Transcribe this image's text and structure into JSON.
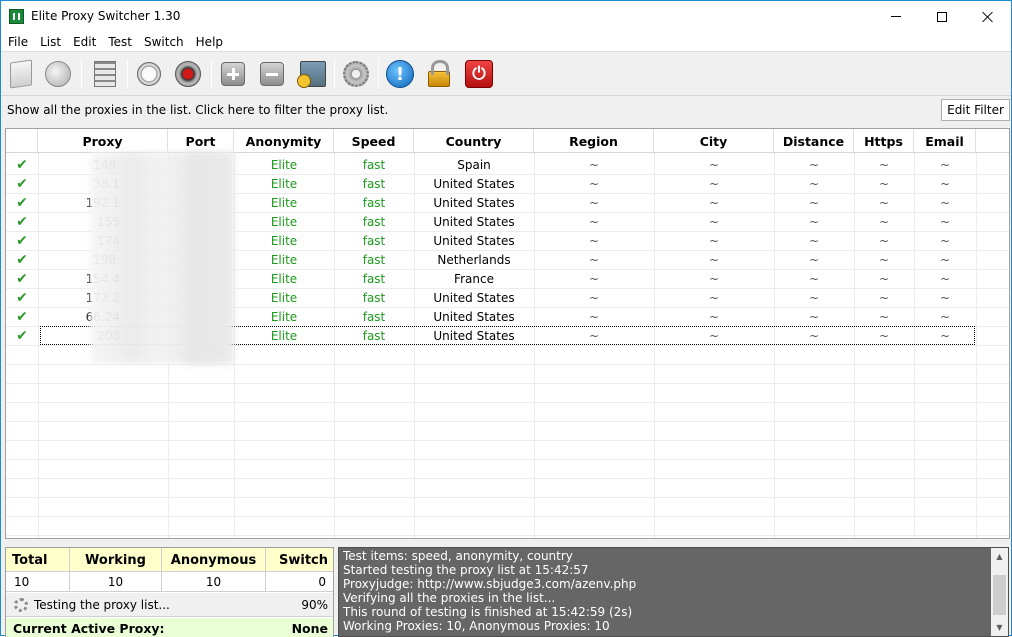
{
  "window": {
    "title": "Elite Proxy Switcher 1.30"
  },
  "menu": [
    "File",
    "List",
    "Edit",
    "Test",
    "Switch",
    "Help"
  ],
  "toolbar": {
    "icons": [
      "document-icon",
      "speaker-icon",
      "list-icon",
      "stopwatch-icon",
      "stop-icon",
      "plus-icon",
      "minus-icon",
      "import-icon",
      "gear-icon",
      "info-icon",
      "lock-icon",
      "power-icon"
    ]
  },
  "filter": {
    "text": "Show all the proxies in the list. Click here to filter the proxy list.",
    "button": "Edit Filter"
  },
  "grid": {
    "columns": [
      "Proxy",
      "Port",
      "Anonymity",
      "Speed",
      "Country",
      "Region",
      "City",
      "Distance",
      "Https",
      "Email"
    ],
    "rows": [
      {
        "proxy": "149.",
        "anonymity": "Elite",
        "speed": "fast",
        "country": "Spain",
        "region": "~",
        "city": "~",
        "distance": "~",
        "https": "~",
        "email": "~"
      },
      {
        "proxy": "38.1",
        "anonymity": "Elite",
        "speed": "fast",
        "country": "United States",
        "region": "~",
        "city": "~",
        "distance": "~",
        "https": "~",
        "email": "~"
      },
      {
        "proxy": "192.1",
        "anonymity": "Elite",
        "speed": "fast",
        "country": "United States",
        "region": "~",
        "city": "~",
        "distance": "~",
        "https": "~",
        "email": "~"
      },
      {
        "proxy": "155",
        "anonymity": "Elite",
        "speed": "fast",
        "country": "United States",
        "region": "~",
        "city": "~",
        "distance": "~",
        "https": "~",
        "email": "~"
      },
      {
        "proxy": "174",
        "anonymity": "Elite",
        "speed": "fast",
        "country": "United States",
        "region": "~",
        "city": "~",
        "distance": "~",
        "https": "~",
        "email": "~"
      },
      {
        "proxy": "198.",
        "anonymity": "Elite",
        "speed": "fast",
        "country": "Netherlands",
        "region": "~",
        "city": "~",
        "distance": "~",
        "https": "~",
        "email": "~"
      },
      {
        "proxy": "154.4",
        "anonymity": "Elite",
        "speed": "fast",
        "country": "France",
        "region": "~",
        "city": "~",
        "distance": "~",
        "https": "~",
        "email": "~"
      },
      {
        "proxy": "173.2",
        "anonymity": "Elite",
        "speed": "fast",
        "country": "United States",
        "region": "~",
        "city": "~",
        "distance": "~",
        "https": "~",
        "email": "~"
      },
      {
        "proxy": "66.24",
        "anonymity": "Elite",
        "speed": "fast",
        "country": "United States",
        "region": "~",
        "city": "~",
        "distance": "~",
        "https": "~",
        "email": "~"
      },
      {
        "proxy": "208",
        "anonymity": "Elite",
        "speed": "fast",
        "country": "United States",
        "region": "~",
        "city": "~",
        "distance": "~",
        "https": "~",
        "email": "~"
      }
    ]
  },
  "stats": {
    "headers": [
      "Total",
      "Working",
      "Anonymous",
      "Switch"
    ],
    "values": [
      "10",
      "10",
      "10",
      "0"
    ],
    "progress_text": "Testing the proxy list...",
    "progress_percent": "90%",
    "active_label": "Current Active Proxy:",
    "active_value": "None"
  },
  "log": [
    "Test items: speed, anonymity, country",
    "Started testing the proxy list at 15:42:57",
    "Proxyjudge: http://www.sbjudge3.com/azenv.php",
    "Verifying all the proxies in the list...",
    "This round of testing is finished at 15:42:59 (2s)",
    "Working Proxies: 10, Anonymous Proxies: 10"
  ],
  "colors": {
    "accent": "#1c8bd3",
    "elite": "#1c9a1c",
    "stats_header": "#ffffcc",
    "active_proxy": "#eaffd5",
    "log_bg": "#666666"
  }
}
